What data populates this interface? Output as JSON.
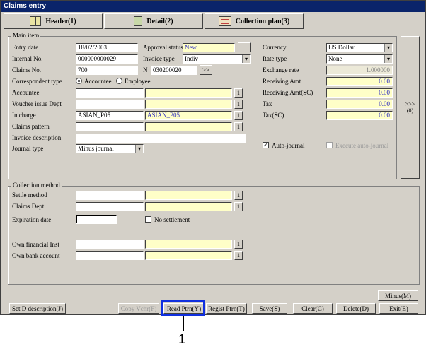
{
  "window": {
    "title": "Claims entry"
  },
  "tabs": [
    {
      "label": "Header(1)",
      "icon": "book-icon"
    },
    {
      "label": "Detail(2)",
      "icon": "document-icon"
    },
    {
      "label": "Collection plan(3)",
      "icon": "envelope-icon"
    }
  ],
  "main_item": {
    "caption": "Main item",
    "entry_date": {
      "label": "Entry date",
      "value": "18/02/2003"
    },
    "internal_no": {
      "label": "Internal No.",
      "value": "000000000029"
    },
    "claims_no": {
      "label": "Claims No.",
      "value": "700"
    },
    "approval_status": {
      "label": "Approval status",
      "value": "New"
    },
    "invoice_type": {
      "label": "Invoice type",
      "value": "Indiv"
    },
    "n_field": {
      "label": "N",
      "value": "030200020",
      "button": ">>"
    },
    "correspondent_type": {
      "label": "Correspondent type",
      "options": [
        "Accountee",
        "Employee"
      ],
      "selected": "Accountee"
    },
    "accountee": {
      "label": "Accountee",
      "code": "",
      "name": "",
      "button": "1"
    },
    "voucher_issue_dept": {
      "label": "Voucher issue Dept",
      "code": "",
      "name": "",
      "button": "1"
    },
    "in_charge": {
      "label": "In charge",
      "code": "ASIAN_P05",
      "name": "ASIAN_P05",
      "button": "1"
    },
    "claims_pattern": {
      "label": "Claims pattern",
      "code": "",
      "name": "",
      "button": "1"
    },
    "invoice_description": {
      "label": "Invoice description",
      "value": ""
    },
    "journal_type": {
      "label": "Journal type",
      "value": "Minus journal"
    },
    "currency": {
      "label": "Currency",
      "value": "US Dollar"
    },
    "rate_type": {
      "label": "Rate type",
      "value": "None"
    },
    "exchange_rate": {
      "label": "Exchange rate",
      "value": "1.000000"
    },
    "receiving_amt": {
      "label": "Receiving Amt",
      "value": "0.00"
    },
    "receiving_amt_sc": {
      "label": "Receiving Amt(SC)",
      "value": "0.00"
    },
    "tax": {
      "label": "Tax",
      "value": "0.00"
    },
    "tax_sc": {
      "label": "Tax(SC)",
      "value": "0.00"
    },
    "auto_journal": {
      "label": "Auto-journal",
      "checked": true
    },
    "execute_auto_journal": {
      "label": "Execute auto-journal",
      "checked": false
    },
    "side_button": ">>>(0)"
  },
  "collection_method": {
    "caption": "Collection method",
    "settle_method": {
      "label": "Settle method",
      "code": "",
      "name": "",
      "button": "1"
    },
    "claims_dept": {
      "label": "Claims Dept",
      "code": "",
      "name": "",
      "button": "1"
    },
    "expiration_date": {
      "label": "Expiration date",
      "value": ""
    },
    "no_settlement": {
      "label": "No settlement",
      "checked": false
    },
    "own_financial_inst": {
      "label": "Own financial Inst",
      "code": "",
      "name": "",
      "button": "1"
    },
    "own_bank_account": {
      "label": "Own bank account",
      "code": "",
      "name": "",
      "button": "1"
    }
  },
  "footer": {
    "minus": "Minus(M)",
    "set_d_description": "Set D description(J)",
    "copy_vchr": "Copy Vchr(F)",
    "read_ptrn": "Read Ptrn(Y)",
    "regist_ptrn": "Regist Ptrn(T)",
    "save": "Save(S)",
    "clear": "Clear(C)",
    "delete": "Delete(D)",
    "exit": "Exit(E)"
  },
  "annotation": {
    "callout_number": "1"
  },
  "colors": {
    "title_bar": "#0a246a",
    "highlight": "#1030e0",
    "field_yellow": "#ffffc8"
  }
}
